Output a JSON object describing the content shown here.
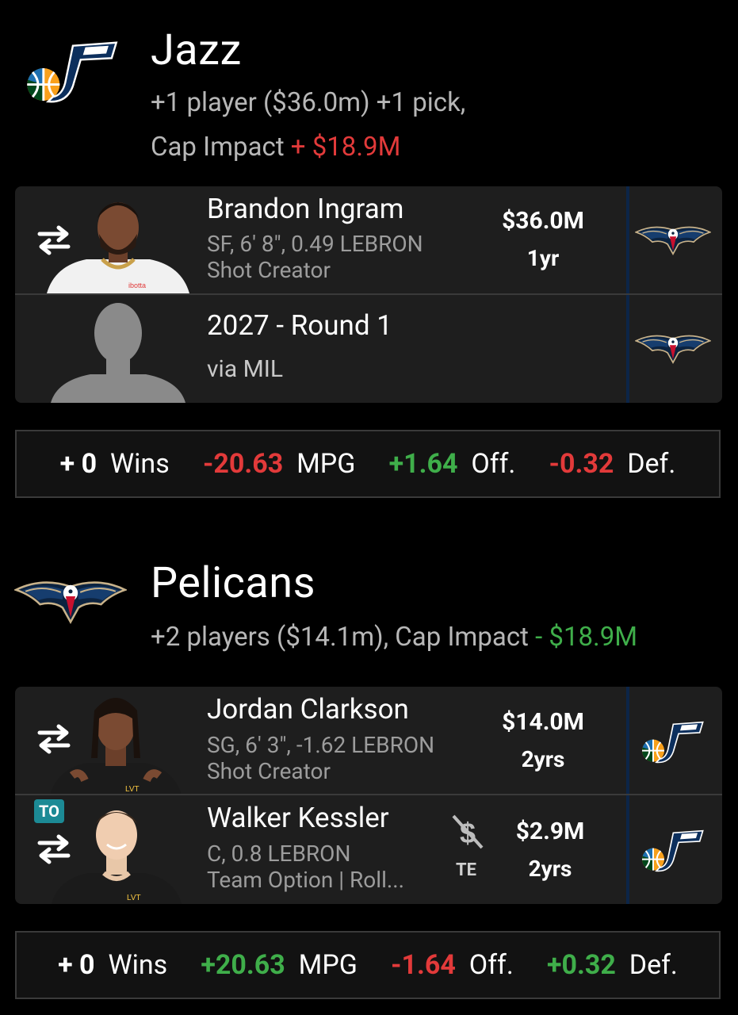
{
  "colors": {
    "background": "#000000",
    "card": "#1e1e1e",
    "negative": "#e23a3a",
    "positive": "#3fae4a",
    "team_divider": "#0c2548",
    "badge": "#1c8a95"
  },
  "jazz": {
    "name": "Jazz",
    "logo_icon": "jazz-logo",
    "summary_line1": "+1 player ($36.0m) +1 pick,",
    "cap_label": "Cap Impact",
    "cap_value": "+ $18.9M",
    "assets": [
      {
        "name": "Brandon Ingram",
        "meta1": "SF, 6' 8\", 0.49 LEBRON",
        "meta2": "Shot Creator",
        "salary": "$36.0M",
        "years": "1yr",
        "from_logo": "pelicans-logo"
      },
      {
        "name": "2027 - Round 1",
        "meta1": "via MIL",
        "from_logo": "pelicans-logo"
      }
    ],
    "stats": {
      "wins_value": "+ 0",
      "wins_label": "Wins",
      "mpg_value": "-20.63",
      "mpg_label": "MPG",
      "off_value": "+1.64",
      "off_label": "Off.",
      "def_value": "-0.32",
      "def_label": "Def."
    }
  },
  "pelicans": {
    "name": "Pelicans",
    "logo_icon": "pelicans-logo",
    "summary_line1": "+2 players ($14.1m), Cap Impact",
    "cap_value": "- $18.9M",
    "assets": [
      {
        "name": "Jordan Clarkson",
        "meta1": "SG, 6' 3\", -1.62 LEBRON",
        "meta2": "Shot Creator",
        "salary": "$14.0M",
        "years": "2yrs",
        "from_logo": "jazz-logo"
      },
      {
        "badge": "TO",
        "name": "Walker Kessler",
        "meta1": "C, 0.8 LEBRON",
        "meta2": "Team Option | Roll...",
        "te_label": "TE",
        "salary": "$2.9M",
        "years": "2yrs",
        "from_logo": "jazz-logo"
      }
    ],
    "stats": {
      "wins_value": "+ 0",
      "wins_label": "Wins",
      "mpg_value": "+20.63",
      "mpg_label": "MPG",
      "off_value": "-1.64",
      "off_label": "Off.",
      "def_value": "+0.32",
      "def_label": "Def."
    }
  }
}
